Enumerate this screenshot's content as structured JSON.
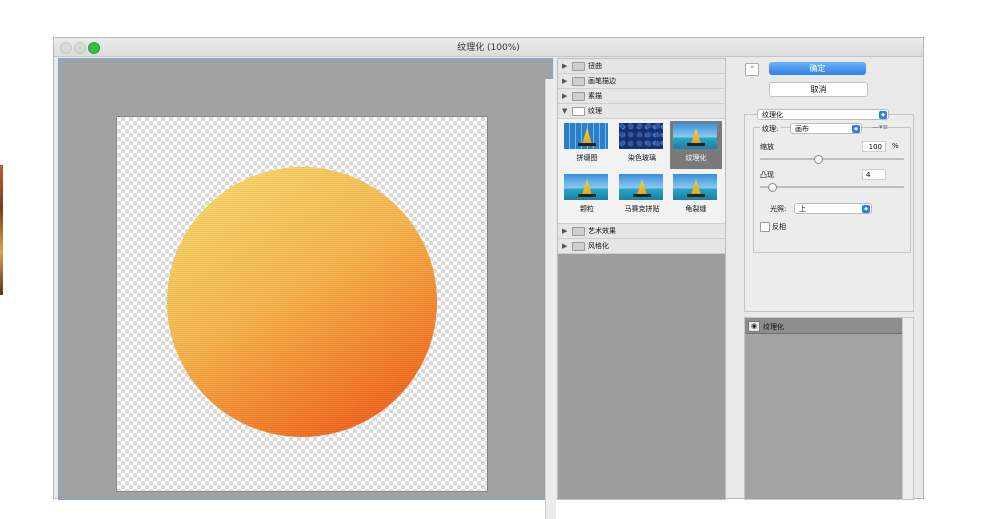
{
  "window": {
    "title": "纹理化 (100%)"
  },
  "filter_gallery": {
    "folders_top": [
      {
        "label": "扭曲",
        "expanded": false
      },
      {
        "label": "画笔描边",
        "expanded": false
      },
      {
        "label": "素描",
        "expanded": false
      },
      {
        "label": "纹理",
        "expanded": true
      }
    ],
    "thumbnails": [
      {
        "label": "拼缀图"
      },
      {
        "label": "染色玻璃"
      },
      {
        "label": "纹理化",
        "selected": true
      },
      {
        "label": "颗粒"
      },
      {
        "label": "马赛克拼贴"
      },
      {
        "label": "龟裂缝"
      }
    ],
    "folders_bottom": [
      {
        "label": "艺术效果",
        "expanded": false
      },
      {
        "label": "风格化",
        "expanded": false
      }
    ]
  },
  "buttons": {
    "ok": "确定",
    "cancel": "取消",
    "collapse": "⌃"
  },
  "settings": {
    "filter_select": "纹理化",
    "texture_label": "纹理:",
    "texture_value": "画布",
    "scaling_label": "缩放",
    "scaling_value": "100",
    "scaling_unit": "%",
    "scaling_level": 0.4,
    "relief_label": "凸现",
    "relief_value": "4",
    "relief_level": 0.08,
    "light_label": "光照:",
    "light_value": "上",
    "invert_label": "反相",
    "invert_checked": false
  },
  "layers": [
    {
      "label": "纹理化",
      "visible": true
    }
  ],
  "colors": {
    "accent": "#2e7fe8",
    "close_red": "#e0e0e0",
    "zoom_green": "#31c03f"
  }
}
